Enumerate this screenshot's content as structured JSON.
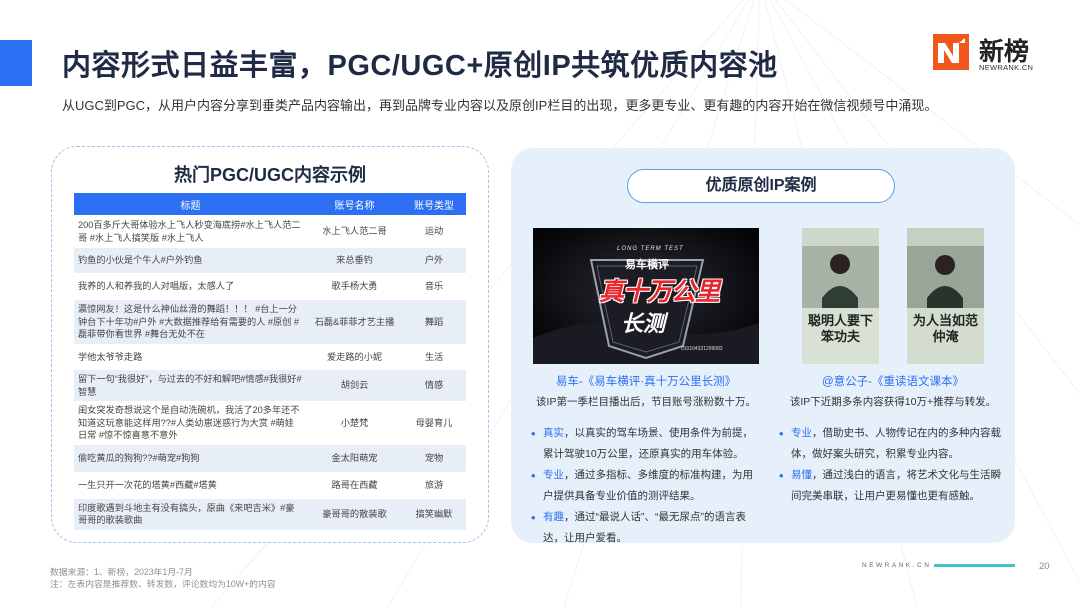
{
  "header": {
    "title": "内容形式日益丰富，PGC/UGC+原创IP共筑优质内容池",
    "subtitle": "从UGC到PGC，从用户内容分享到垂类产品内容输出，再到品牌专业内容以及原创IP栏目的出现，更多更专业、更有趣的内容开始在微信视频号中涌现。"
  },
  "logo": {
    "text": "新榜",
    "sub": "NEWRANK.CN",
    "accent": "#f2561d"
  },
  "left_panel": {
    "heading": "热门PGC/UGC内容示例",
    "columns": [
      "标题",
      "账号名称",
      "账号类型"
    ],
    "rows": [
      [
        "200百多斤大哥体验水上飞人秒变海底捞#水上飞人范二哥 #水上飞人搞笑版 #水上飞人",
        "水上飞人范二哥",
        "运动"
      ],
      [
        "钓鱼的小伙是个牛人#户外钓鱼",
        "来总垂钓",
        "户外"
      ],
      [
        "我养的人和养我的人对唱版，太感人了",
        "歌手杨大勇",
        "音乐"
      ],
      [
        "瀛惊网友！这是什么神仙丝滑的舞蹈！！！ #台上一分钟台下十年功#户外 #大数据推荐给有需要的人 #原创 #磊菲带你看世界 #舞台无处不在",
        "石磊&菲菲才艺主播",
        "舞蹈"
      ],
      [
        "学他太爷爷走路",
        "爱走路的小妮",
        "生活"
      ],
      [
        "留下一句“我很好”，与过去的不好和解吧#情感#我很好#智慧",
        "胡剑云",
        "情感"
      ],
      [
        "闺女突发奇想说这个是自动洗碗机，我活了20多年还不知道这玩意能这样用??#人类幼崽迷惑行为大赏 #萌娃日常 #惊不惊喜意不意外",
        "小楚梵",
        "母婴育儿"
      ],
      [
        "偷吃黄瓜的狗狗??#萌宠#狗狗",
        "金太阳萌宠",
        "宠物"
      ],
      [
        "一生只开一次花的塔黄#西藏#塔黄",
        "路哥在西藏",
        "旅游"
      ],
      [
        "印度歌遇到斗地主有没有搞头，原曲《来吧吉米》#豪哥哥的歌装歌曲",
        "豪哥哥的散装歌",
        "搞笑幽默"
      ]
    ]
  },
  "right_panel": {
    "heading": "优质原创IP案例",
    "case1": {
      "image_banner": "LONG TERM TEST",
      "image_brand": "易车横评",
      "image_main": "真十万公里",
      "image_sub": "长测",
      "image_plate": "010104321299082",
      "title": "易车-《易车横评·真十万公里长测》",
      "desc": "该IP第一季栏目播出后，节目账号涨粉数十万。",
      "points": [
        {
          "key": "真实",
          "text": "，以真实的驾车场景、使用条件为前提，累计驾驶10万公里，还原真实的用车体验。"
        },
        {
          "key": "专业",
          "text": "，通过多指标、多维度的标准构建，为用户提供具备专业价值的测评结果。"
        },
        {
          "key": "有趣",
          "text": "，通过“最说人话”、“最无尿点”的语言表达，让用户爱看。"
        }
      ]
    },
    "case2": {
      "image_left_title": "聪明人要下笨功夫",
      "image_right_title": "为人当如范仲淹",
      "title": "@意公子-《重读语文课本》",
      "desc": "该IP下近期多条内容获得10万+推荐与转发。",
      "points": [
        {
          "key": "专业",
          "text": "，借助史书、人物传记在内的多种内容载体，做好案头研究，积累专业内容。"
        },
        {
          "key": "易懂",
          "text": "，通过浅白的语言，将艺术文化与生活瞬间完美串联，让用户更易懂也更有感触。"
        }
      ]
    }
  },
  "footer": {
    "source": "数据来源：1、新榜，2023年1月-7月",
    "note": "注：左表内容是推荐数、转发数，评论数均为10W+的内容",
    "brand": "NEWRANK.CN",
    "page": "20"
  },
  "colors": {
    "primary": "#2d6ff2",
    "teal": "#3cc7c6",
    "panel_bg": "#e6f0fb"
  }
}
